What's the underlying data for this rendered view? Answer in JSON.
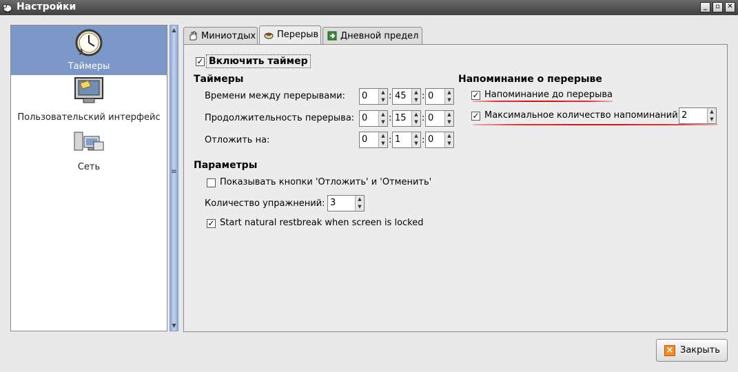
{
  "window": {
    "title": "Настройки"
  },
  "titlebar_buttons": [
    "_",
    "▫",
    "✕"
  ],
  "sidebar": {
    "items": [
      {
        "label": "Таймеры",
        "icon": "clock-icon"
      },
      {
        "label": "Пользовательский интерфейс",
        "icon": "monitor-icon"
      },
      {
        "label": "Сеть",
        "icon": "network-icon"
      }
    ]
  },
  "tabs": [
    {
      "label": "Миниотдых",
      "icon": "hand-icon"
    },
    {
      "label": "Перерыв",
      "icon": "coffee-icon"
    },
    {
      "label": "Дневной предел",
      "icon": "exit-icon"
    }
  ],
  "break_tab": {
    "enable_timer": {
      "label": "Включить таймер",
      "checked": true
    },
    "timers_heading": "Таймеры",
    "rows": [
      {
        "label": "Времени между перерывами:",
        "h": "0",
        "m": "45",
        "s": "0"
      },
      {
        "label": "Продолжительность перерыва:",
        "h": "0",
        "m": "15",
        "s": "0"
      },
      {
        "label": "Отложить на:",
        "h": "0",
        "m": "1",
        "s": "0"
      }
    ],
    "separator": ":",
    "reminder_heading": "Напоминание о перерыве",
    "reminder_before": {
      "label": "Напоминание до перерыва",
      "checked": true
    },
    "max_reminders": {
      "label": "Максимальное количество напоминаний:",
      "checked": true,
      "value": "2"
    },
    "params_heading": "Параметры",
    "show_buttons": {
      "label": "Показывать кнопки 'Отложить' и 'Отменить'",
      "checked": false
    },
    "exercises": {
      "label": "Количество упражнений:",
      "value": "3"
    },
    "natural_break": {
      "label": "Start natural restbreak when screen is locked",
      "checked": true
    }
  },
  "footer": {
    "close_label": "Закрыть"
  },
  "colors": {
    "annotation": "#e01010",
    "selection": "#7b98c8"
  }
}
